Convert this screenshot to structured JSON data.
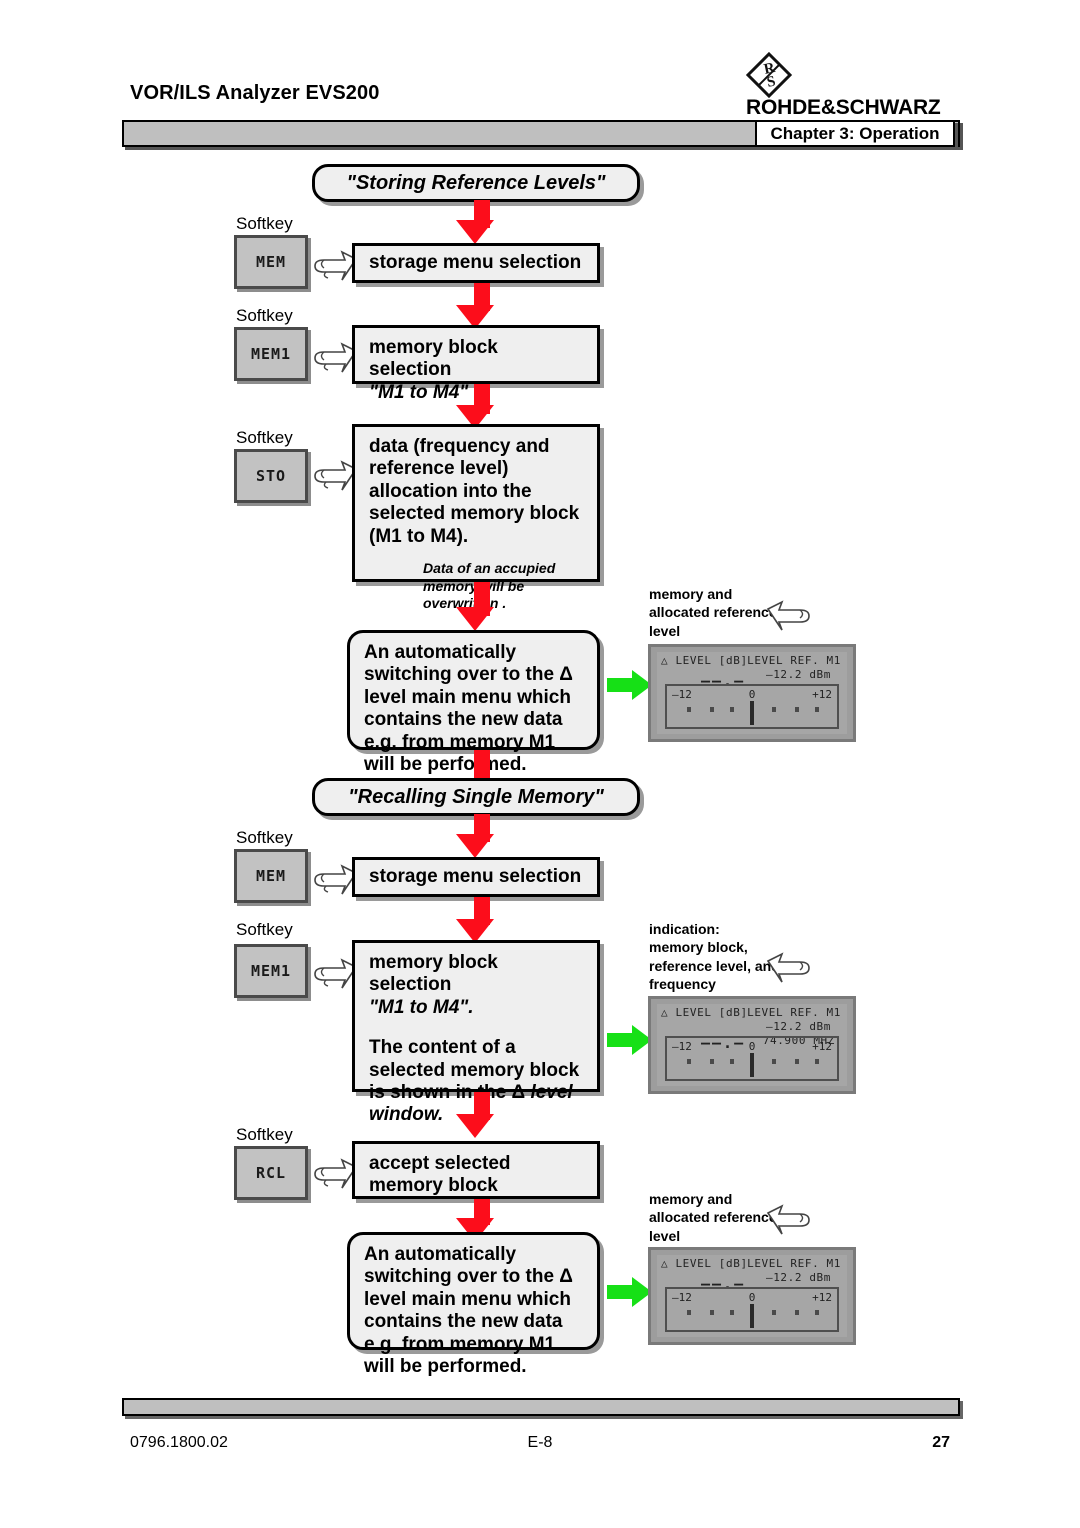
{
  "header": {
    "product_title": "VOR/ILS Analyzer EVS200",
    "brand": "ROHDE&SCHWARZ",
    "brand_mark": "rs-diamond-logo",
    "chapter_tab": "Chapter 3: Operation"
  },
  "footer": {
    "doc_number": "0796.1800.02",
    "revision": "E-8",
    "page_number": "27"
  },
  "colors": {
    "arrow_red": "#fc0d1b",
    "arrow_green": "#16e016",
    "box_fill": "#efefef",
    "bar_gray": "#bfbfbf",
    "lcd_gray": "#9d9d9d"
  },
  "softkey_caption": "Softkey",
  "sections": [
    {
      "banner": "\"Storing Reference Levels\"",
      "steps": [
        {
          "softkey": "MEM",
          "text": "storage menu selection"
        },
        {
          "softkey": "MEM1",
          "text": "memory block selection",
          "text_italic": "\"M1 to M4\""
        },
        {
          "softkey": "STO",
          "text": "data (frequency and reference level) allocation into the selected memory block (M1 to M4).",
          "note": "Data of an accupied memory will be overwritten ."
        },
        {
          "softkey": null,
          "text": "An automatically switching over to the Δ level main menu which contains the new data e.g. from memory M1 will be performed."
        }
      ]
    },
    {
      "banner": "\"Recalling Single Memory\"",
      "steps": [
        {
          "softkey": "MEM",
          "text": "storage menu selection"
        },
        {
          "softkey": "MEM1",
          "text": "memory block selection",
          "text_italic": "\"M1 to M4\".",
          "text2": "The content of a selected memory block is shown in the Δ ",
          "text2_italic": "level window."
        },
        {
          "softkey": "RCL",
          "text": "accept selected memory block"
        },
        {
          "softkey": null,
          "text": "An automatically switching over to the Δ level main menu which contains the new data e.g. from memory M1 will be performed."
        }
      ]
    }
  ],
  "displays": [
    {
      "caption": "memory and allocated reference level",
      "title_left": "△ LEVEL [dB]",
      "title_right": "LEVEL REF. M1",
      "ref_level": "–12.2  dBm",
      "frequency": null,
      "value": "——.—",
      "scale_left": "–12",
      "scale_center": "0",
      "scale_right": "+12"
    },
    {
      "caption": "indication: memory block, reference level, and frequency",
      "caption_head": "indication:",
      "caption_rest": "memory block, reference level, and frequency",
      "title_left": "△ LEVEL [dB]",
      "title_right": "LEVEL REF. M1",
      "ref_level": "–12.2  dBm",
      "frequency": "74.900 MHZ",
      "value": "——.—",
      "scale_left": "–12",
      "scale_center": "0",
      "scale_right": "+12"
    },
    {
      "caption": "memory and allocated reference level",
      "title_left": "△ LEVEL [dB]",
      "title_right": "LEVEL REF. M1",
      "ref_level": "–12.2  dBm",
      "frequency": null,
      "value": "——.—",
      "scale_left": "–12",
      "scale_center": "0",
      "scale_right": "+12"
    }
  ]
}
